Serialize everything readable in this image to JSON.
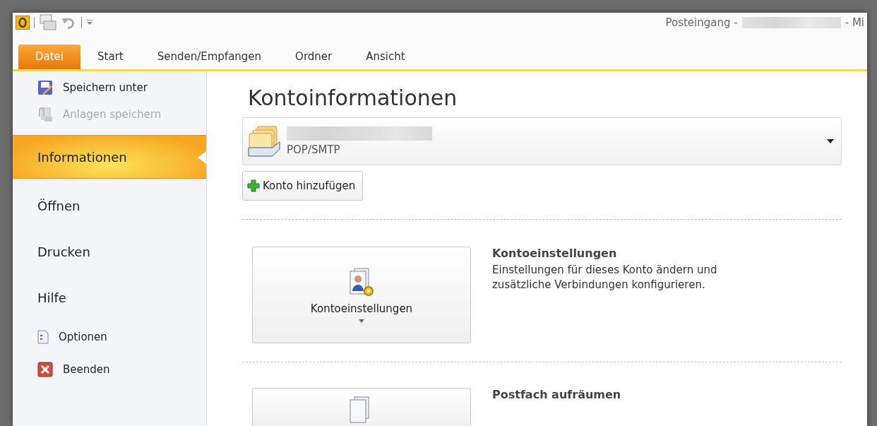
{
  "window": {
    "title_prefix": "Posteingang -",
    "title_suffix": "- Mi"
  },
  "ribbon_tabs": [
    {
      "label": "Datei",
      "selected": true
    },
    {
      "label": "Start",
      "selected": false
    },
    {
      "label": "Senden/Empfangen",
      "selected": false
    },
    {
      "label": "Ordner",
      "selected": false
    },
    {
      "label": "Ansicht",
      "selected": false
    }
  ],
  "sidebar": {
    "items": [
      {
        "kind": "command",
        "label": "Speichern unter",
        "disabled": false,
        "selected": false
      },
      {
        "kind": "command",
        "label": "Anlagen speichern",
        "disabled": true,
        "selected": false
      },
      {
        "kind": "page",
        "label": "Informationen",
        "disabled": false,
        "selected": true
      },
      {
        "kind": "page",
        "label": "Öffnen",
        "disabled": false,
        "selected": false
      },
      {
        "kind": "page",
        "label": "Drucken",
        "disabled": false,
        "selected": false
      },
      {
        "kind": "page",
        "label": "Hilfe",
        "disabled": false,
        "selected": false
      },
      {
        "kind": "command",
        "label": "Optionen",
        "disabled": false,
        "selected": false
      },
      {
        "kind": "command",
        "label": "Beenden",
        "disabled": false,
        "selected": false
      }
    ]
  },
  "content": {
    "title": "Kontoinformationen",
    "account": {
      "type": "POP/SMTP"
    },
    "add_account_button": "Konto hinzufügen",
    "sections": [
      {
        "button": "Kontoeinstellungen",
        "heading": "Kontoeinstellungen",
        "description": "Einstellungen für dieses Konto ändern und zusätzliche Verbindungen konfigurieren."
      },
      {
        "heading": "Postfach aufräumen"
      }
    ]
  }
}
